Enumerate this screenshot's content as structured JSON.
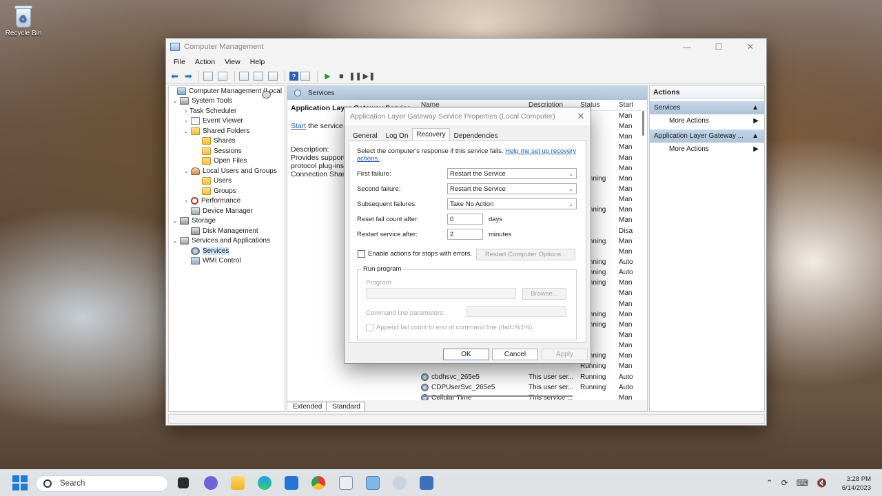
{
  "desktop": {
    "recycle_bin_label": "Recycle Bin"
  },
  "window": {
    "title": "Computer Management",
    "controls": {
      "minimize": "—",
      "maximize": "☐",
      "close": "✕"
    },
    "menu": [
      "File",
      "Action",
      "View",
      "Help"
    ]
  },
  "tree": {
    "root": "Computer Management (Local",
    "system_tools": "System Tools",
    "task_scheduler": "Task Scheduler",
    "event_viewer": "Event Viewer",
    "shared_folders": "Shared Folders",
    "shares": "Shares",
    "sessions": "Sessions",
    "open_files": "Open Files",
    "local_users": "Local Users and Groups",
    "users": "Users",
    "groups": "Groups",
    "performance": "Performance",
    "device_manager": "Device Manager",
    "storage": "Storage",
    "disk_management": "Disk Management",
    "services_apps": "Services and Applications",
    "services": "Services",
    "wmi": "WMI Control"
  },
  "center": {
    "header": "Services",
    "service_title": "Application Layer Gateway Service",
    "start_link": "Start",
    "start_suffix": " the service",
    "description_label": "Description:",
    "description_lines": [
      "Provides support",
      "protocol plug-ins",
      "Connection Shar"
    ],
    "columns": {
      "name": "Name",
      "description": "Description",
      "status": "Status",
      "startup": "Start"
    },
    "rows": [
      {
        "name": "",
        "desc": "",
        "status": "",
        "startup": "Man"
      },
      {
        "name": "",
        "desc": "",
        "status": "",
        "startup": "Man"
      },
      {
        "name": "",
        "desc": "",
        "status": "",
        "startup": "Man"
      },
      {
        "name": "",
        "desc": "",
        "status": "",
        "startup": "Man"
      },
      {
        "name": "",
        "desc": "",
        "status": "",
        "startup": "Man"
      },
      {
        "name": "",
        "desc": "",
        "status": "",
        "startup": "Man"
      },
      {
        "name": "",
        "desc": "",
        "status": "Running",
        "startup": "Man"
      },
      {
        "name": "",
        "desc": "",
        "status": "",
        "startup": "Man"
      },
      {
        "name": "",
        "desc": "",
        "status": "",
        "startup": "Man"
      },
      {
        "name": "",
        "desc": "",
        "status": "Running",
        "startup": "Man"
      },
      {
        "name": "",
        "desc": "",
        "status": "",
        "startup": "Man"
      },
      {
        "name": "",
        "desc": "",
        "status": "",
        "startup": "Disa"
      },
      {
        "name": "",
        "desc": "",
        "status": "Running",
        "startup": "Man"
      },
      {
        "name": "",
        "desc": "",
        "status": "",
        "startup": "Man"
      },
      {
        "name": "",
        "desc": "",
        "status": "Running",
        "startup": "Auto"
      },
      {
        "name": "",
        "desc": "",
        "status": "Running",
        "startup": "Auto"
      },
      {
        "name": "",
        "desc": "",
        "status": "Running",
        "startup": "Man"
      },
      {
        "name": "",
        "desc": "",
        "status": "",
        "startup": "Man"
      },
      {
        "name": "",
        "desc": "",
        "status": "",
        "startup": "Man"
      },
      {
        "name": "",
        "desc": "",
        "status": "Running",
        "startup": "Man"
      },
      {
        "name": "",
        "desc": "",
        "status": "Running",
        "startup": "Man"
      },
      {
        "name": "",
        "desc": "",
        "status": "",
        "startup": "Man"
      },
      {
        "name": "",
        "desc": "",
        "status": "",
        "startup": "Man"
      },
      {
        "name": "",
        "desc": "",
        "status": "Running",
        "startup": "Man"
      },
      {
        "name": "",
        "desc": "",
        "status": "Running",
        "startup": "Man"
      },
      {
        "name": "cbdhsvc_265e5",
        "desc": "This user ser...",
        "status": "Running",
        "startup": "Auto"
      },
      {
        "name": "CDPUserSvc_265e5",
        "desc": "This user ser...",
        "status": "Running",
        "startup": "Auto"
      },
      {
        "name": "Cellular Time",
        "desc": "This service ...",
        "status": "",
        "startup": "Man"
      }
    ],
    "tabs": [
      "Extended",
      "Standard"
    ]
  },
  "actions": {
    "title": "Actions",
    "section1": "Services",
    "more_actions_1": "More Actions",
    "section2": "Application Layer Gateway ...",
    "more_actions_2": "More Actions"
  },
  "dialog": {
    "title": "Application Layer Gateway Service Properties (Local Computer)",
    "close": "✕",
    "tabs": [
      "General",
      "Log On",
      "Recovery",
      "Dependencies"
    ],
    "intro": "Select the computer's response if this service fails. ",
    "help_link": "Help me set up recovery actions.",
    "first_failure_label": "First failure:",
    "first_failure_value": "Restart the Service",
    "second_failure_label": "Second failure:",
    "second_failure_value": "Restart the Service",
    "subsequent_label": "Subsequent failures:",
    "subsequent_value": "Take No Action",
    "reset_label": "Reset fail count after:",
    "reset_value": "0",
    "reset_unit": "days",
    "restart_label": "Restart service after:",
    "restart_value": "2",
    "restart_unit": "minutes",
    "enable_actions_label": "Enable actions for stops with errors.",
    "restart_computer_options": "Restart Computer Options...",
    "run_program_group": "Run program",
    "program_label": "Program:",
    "browse": "Browse...",
    "cmd_params_label": "Command line parameters:",
    "append_label": "Append fail count to end of command line (/fail=%1%)",
    "ok": "OK",
    "cancel": "Cancel",
    "apply": "Apply"
  },
  "taskbar": {
    "search_placeholder": "Search",
    "time": "3:28 PM",
    "date": "6/14/2023"
  }
}
